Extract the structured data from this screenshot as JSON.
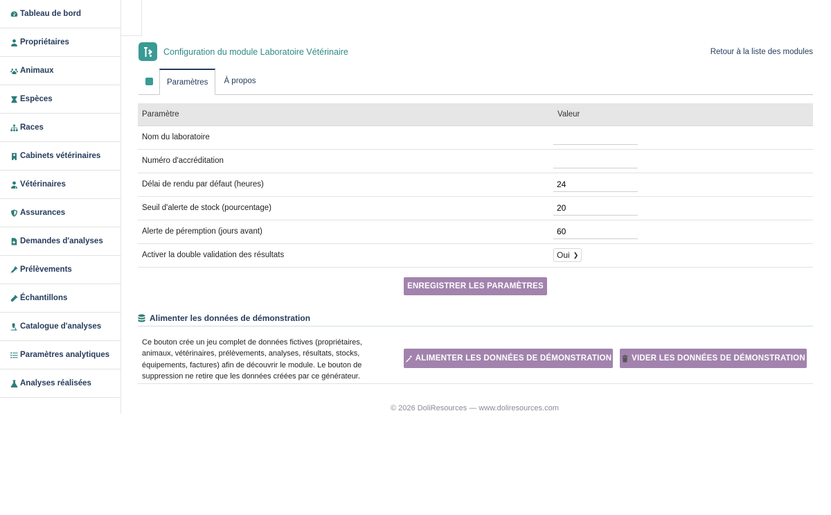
{
  "sidebar": {
    "items": [
      {
        "label": "Tableau de bord",
        "icon": "dashboard-icon"
      },
      {
        "label": "Propriétaires",
        "icon": "user-icon"
      },
      {
        "label": "Animaux",
        "icon": "paw-icon"
      },
      {
        "label": "Espèces",
        "icon": "hourglass-icon"
      },
      {
        "label": "Races",
        "icon": "sitemap-icon"
      },
      {
        "label": "Cabinets vétérinaires",
        "icon": "clinic-icon"
      },
      {
        "label": "Vétérinaires",
        "icon": "doctor-icon"
      },
      {
        "label": "Assurances",
        "icon": "shield-icon"
      },
      {
        "label": "Demandes d'analyses",
        "icon": "file-medical-icon"
      },
      {
        "label": "Prélèvements",
        "icon": "syringe-icon"
      },
      {
        "label": "Échantillons",
        "icon": "vial-icon"
      },
      {
        "label": "Catalogue d'analyses",
        "icon": "microscope-icon"
      },
      {
        "label": "Paramètres analytiques",
        "icon": "list-icon"
      },
      {
        "label": "Analyses réalisées",
        "icon": "flask-icon"
      }
    ]
  },
  "header": {
    "title": "Configuration du module Laboratoire Vétérinaire",
    "back_link": "Retour à la liste des modules"
  },
  "tabs": [
    {
      "label": "Paramètres",
      "active": true
    },
    {
      "label": "À propos",
      "active": false
    }
  ],
  "params": {
    "col_param": "Paramètre",
    "col_value": "Valeur",
    "rows": [
      {
        "label": "Nom du laboratoire",
        "value": ""
      },
      {
        "label": "Numéro d'accréditation",
        "value": ""
      },
      {
        "label": "Délai de rendu par défaut (heures)",
        "value": "24"
      },
      {
        "label": "Seuil d'alerte de stock (pourcentage)",
        "value": "20"
      },
      {
        "label": "Alerte de péremption (jours avant)",
        "value": "60"
      }
    ],
    "select_row": {
      "label": "Activer la double validation des résultats",
      "value": "Oui"
    },
    "save_label": "ENREGISTRER LES PARAMÈTRES"
  },
  "demo": {
    "title": "Alimenter les données de démonstration",
    "description": "Ce bouton crée un jeu complet de données fictives (propriétaires, animaux, vétérinaires, prélèvements, analyses, résultats, stocks, équipements, factures) afin de découvrir le module. Le bouton de suppression ne retire que les données créées par ce générateur.",
    "fill_label": "ALIMENTER LES DONNÉES DE DÉMONSTRATION",
    "clear_label": "VIDER LES DONNÉES DE DÉMONSTRATION"
  },
  "footer": {
    "text": "© 2026 DoliResources — www.doliresources.com"
  },
  "colors": {
    "accent": "#3a9a94",
    "button": "#a283ad",
    "nav_text": "#263c5c"
  }
}
